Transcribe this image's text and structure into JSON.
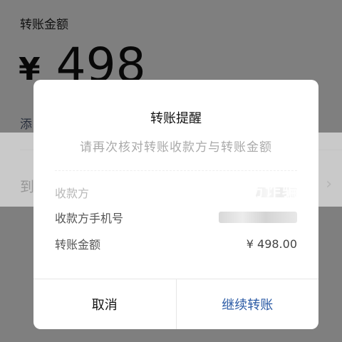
{
  "background": {
    "amount_label": "转账金额",
    "currency": "¥",
    "amount": "498",
    "add_note": "添",
    "arrive_label": "到"
  },
  "dialog": {
    "title": "转账提醒",
    "reminder": "请再次核对转账收款方与转账金额",
    "rows": [
      {
        "label": "收款方",
        "value": ""
      },
      {
        "label": "收款方手机号",
        "value": ""
      },
      {
        "label": "转账金额",
        "value": "¥ 498.00"
      }
    ],
    "cancel_label": "取消",
    "continue_label": "继续转账"
  },
  "watermark": "防诈骗"
}
